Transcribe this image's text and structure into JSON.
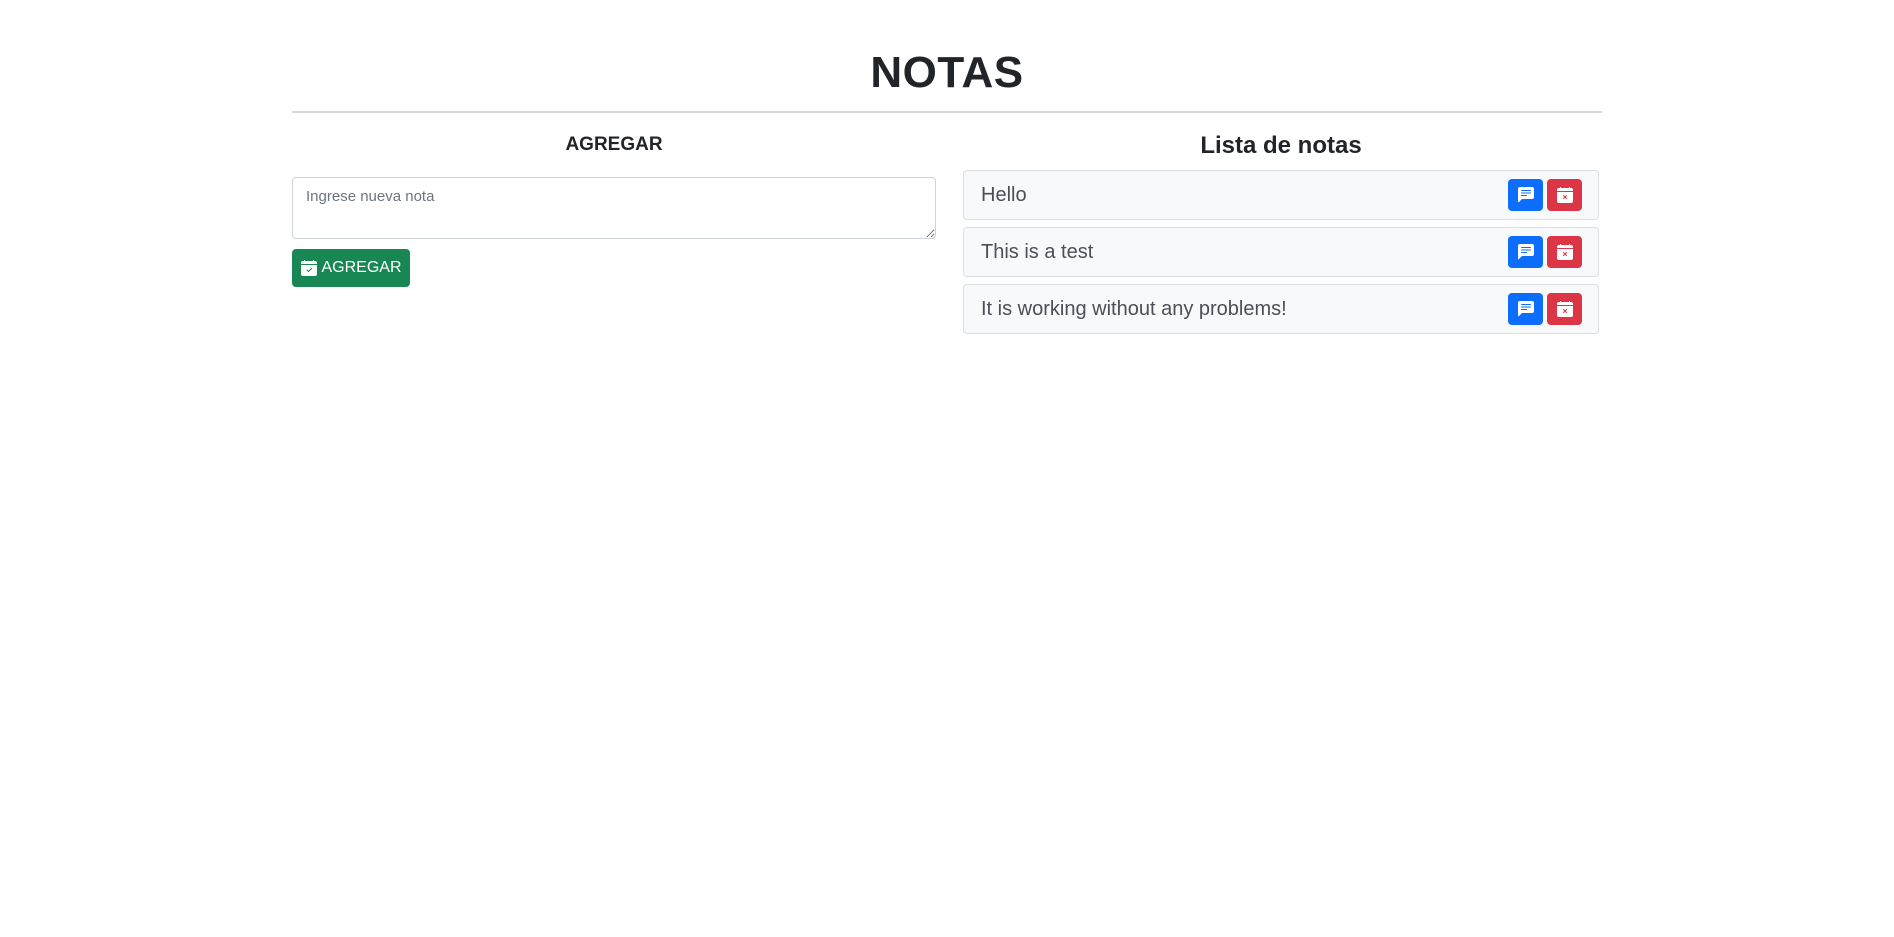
{
  "header": {
    "title": "NOTAS"
  },
  "add_section": {
    "heading": "AGREGAR",
    "input_placeholder": "Ingrese nueva nota",
    "input_value": "",
    "button_label": "AGREGAR",
    "button_icon": "calendar-check-icon"
  },
  "list_section": {
    "heading": "Lista de notas",
    "notes": [
      {
        "text": "Hello",
        "edit_icon": "chat-left-text-icon",
        "delete_icon": "calendar-x-icon"
      },
      {
        "text": "This is a test",
        "edit_icon": "chat-left-text-icon",
        "delete_icon": "calendar-x-icon"
      },
      {
        "text": "It is working without any problems!",
        "edit_icon": "chat-left-text-icon",
        "delete_icon": "calendar-x-icon"
      }
    ]
  },
  "colors": {
    "success": "#198754",
    "primary": "#0d6efd",
    "danger": "#dc3545"
  }
}
